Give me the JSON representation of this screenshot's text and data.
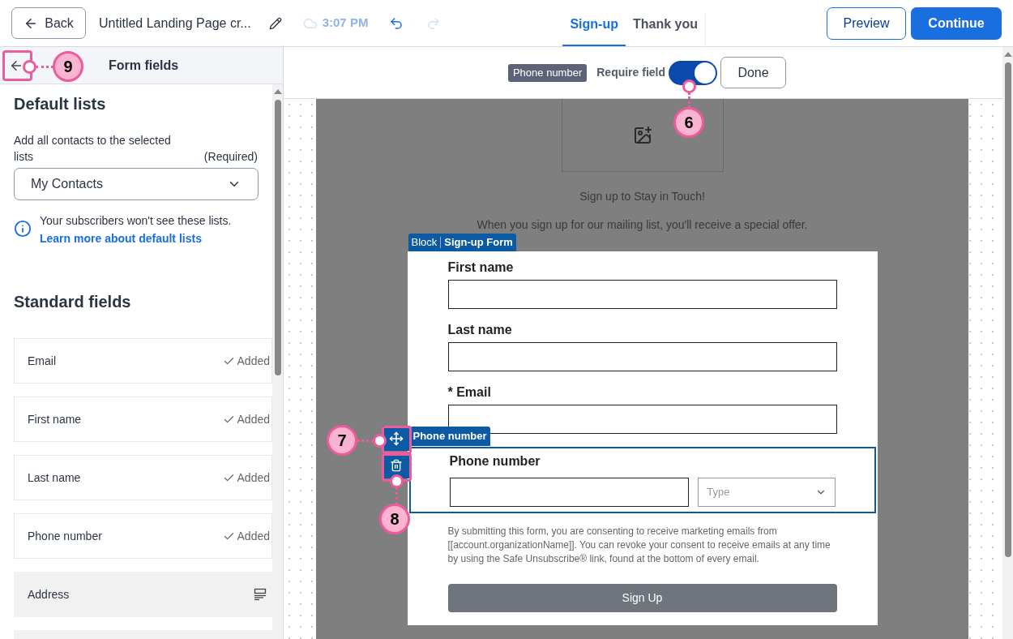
{
  "header": {
    "back": "Back",
    "title": "Untitled Landing Page cr...",
    "saved_time": "3:07 PM",
    "tabs": [
      {
        "label": "Sign-up",
        "selected": true
      },
      {
        "label": "Thank you",
        "selected": false
      }
    ],
    "preview": "Preview",
    "continue": "Continue"
  },
  "sidebar": {
    "title": "Form fields",
    "default_lists": {
      "heading": "Default lists",
      "label": "Add all contacts to the selected lists",
      "required": "(Required)",
      "select_value": "My Contacts",
      "info": "Your subscribers won't see these lists.",
      "link": "Learn more about default lists"
    },
    "standard_fields": {
      "heading": "Standard fields",
      "items": [
        {
          "label": "Email",
          "added": true,
          "status": "Added"
        },
        {
          "label": "First name",
          "added": true,
          "status": "Added"
        },
        {
          "label": "Last name",
          "added": true,
          "status": "Added"
        },
        {
          "label": "Phone number",
          "added": true,
          "status": "Added"
        },
        {
          "label": "Address",
          "added": false
        }
      ]
    }
  },
  "toolbar": {
    "field_tag": "Phone number",
    "require_label": "Require field",
    "require_on": true,
    "done": "Done"
  },
  "canvas": {
    "heading": "Sign up to Stay in Touch!",
    "subtext": "When you sign up for our mailing list, you'll receive a special offer.",
    "block_tag": {
      "prefix": "Block",
      "name": "Sign-up Form"
    },
    "fields": [
      {
        "label": "First name",
        "kind": "text",
        "selected": false
      },
      {
        "label": "Last name",
        "kind": "text",
        "selected": false
      },
      {
        "label": "* Email",
        "kind": "text",
        "selected": false
      },
      {
        "label": "Phone number",
        "kind": "phone",
        "selected": true,
        "tag": "Phone number",
        "type_placeholder": "Type"
      }
    ],
    "consent": "By submitting this form, you are consenting to receive marketing emails from [[account.organizationName]]. You can revoke your consent to receive emails at any time by using the Safe Unsubscribe® link, found at the bottom of every email.",
    "button": "Sign Up"
  },
  "callouts": [
    {
      "label": "9"
    },
    {
      "label": "6"
    },
    {
      "label": "7"
    },
    {
      "label": "8"
    }
  ]
}
